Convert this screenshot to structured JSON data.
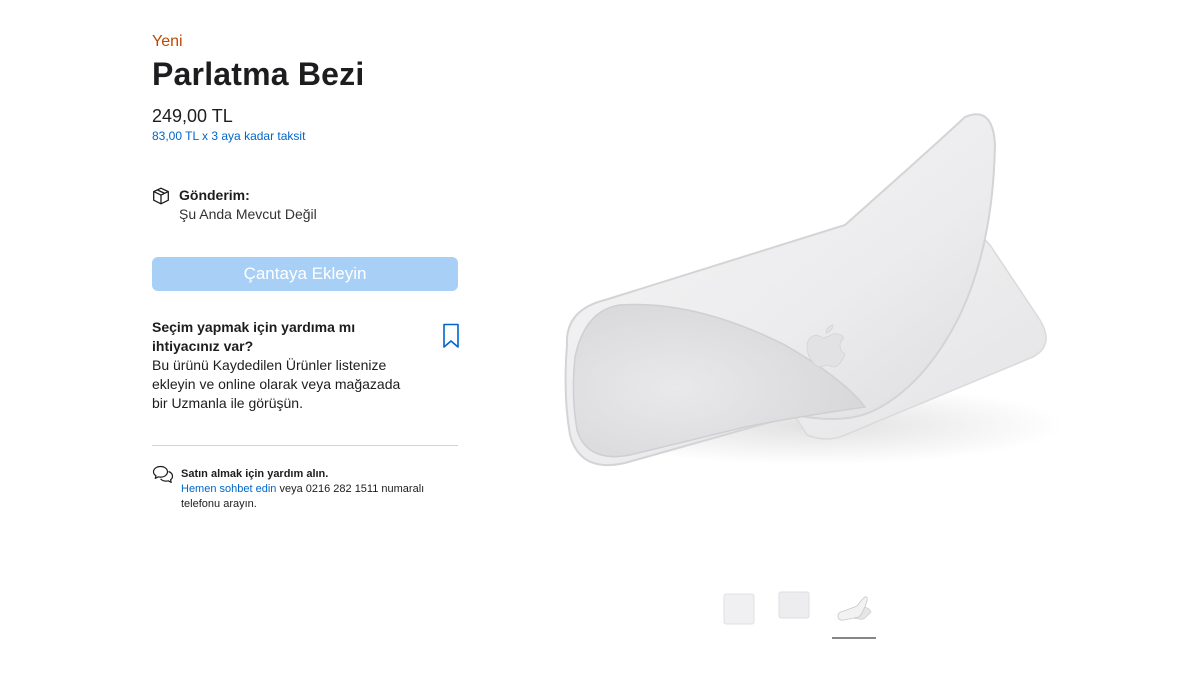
{
  "product": {
    "badge": "Yeni",
    "title": "Parlatma Bezi",
    "price": "249,00 TL",
    "installment": "83,00 TL x 3 aya kadar taksit"
  },
  "shipping": {
    "label": "Gönderim:",
    "status": "Şu Anda Mevcut Değil",
    "icon": "package-icon"
  },
  "actions": {
    "add_to_bag": "Çantaya Ekleyin"
  },
  "help": {
    "title": "Seçim yapmak için yardıma mı ihtiyacınız var?",
    "text": "Bu ürünü Kaydedilen Ürünler listenize ekleyin ve online olarak veya mağazada bir Uzmanla ile görüşün.",
    "icon": "bookmark-icon"
  },
  "chat": {
    "title": "Satın almak için yardım alın.",
    "link": "Hemen sohbet edin",
    "rest": " veya 0216 282 1511 numaralı telefonu arayın.",
    "icon": "chat-bubbles-icon"
  },
  "gallery": {
    "thumbnails": [
      "thumbnail-1",
      "thumbnail-2",
      "thumbnail-3"
    ],
    "selected_index": 3
  },
  "colors": {
    "badge": "#bf4800",
    "link": "#0066cc",
    "button_disabled": "#a8d0f7",
    "text": "#1d1d1f"
  }
}
